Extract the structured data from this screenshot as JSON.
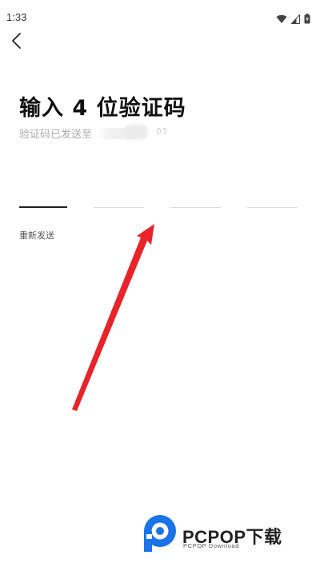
{
  "status_bar": {
    "time": "1:33",
    "icons": [
      "wifi-icon",
      "cellular-signal-icon",
      "battery-charging-icon"
    ]
  },
  "nav": {
    "back_icon": "chevron-left-icon"
  },
  "main": {
    "title": "输入 4 位验证码",
    "subtitle": "验证码已发送至",
    "phone_tail": "03",
    "code_digits": [
      "",
      "",
      "",
      ""
    ],
    "active_box": 0,
    "resend_label": "重新发送"
  },
  "watermark": {
    "brand": "PCPOP下载",
    "tagline": "PCPOP Download"
  },
  "colors": {
    "annotation_arrow": "#e8232a",
    "watermark_logo": "#1a73e8",
    "active_underline": "#222222",
    "inactive_underline": "#dcdcdc"
  }
}
